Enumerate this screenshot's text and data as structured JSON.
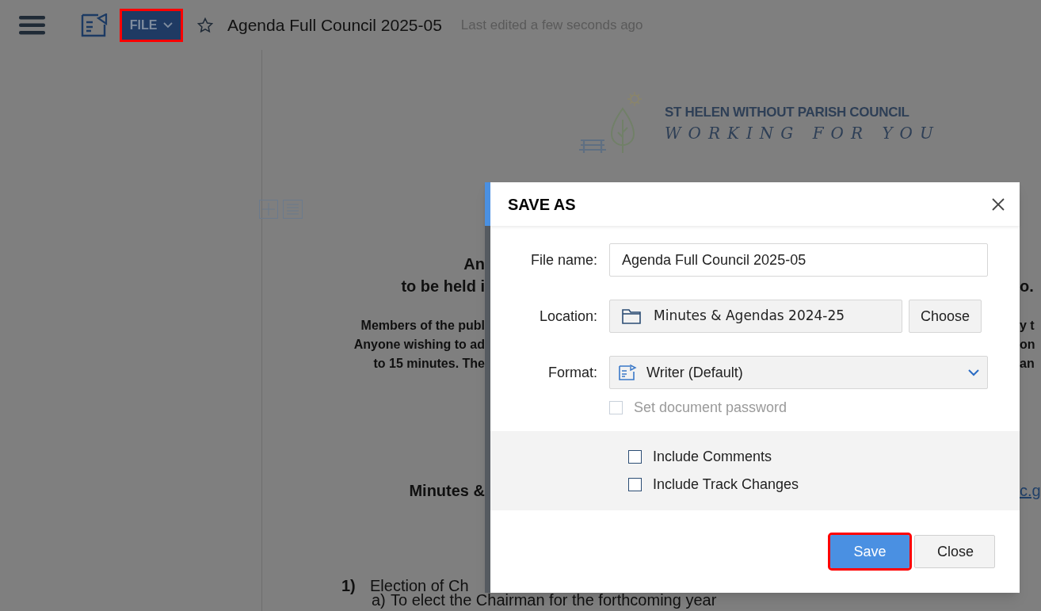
{
  "toolbar": {
    "file_menu": {
      "label": "FILE",
      "highlighted": true
    },
    "starred": false,
    "title": "Agenda Full Council 2025-05",
    "status": "Last edited a few seconds ago"
  },
  "document": {
    "logo": {
      "name": "ST HELEN WITHOUT PARISH COUNCIL",
      "tagline": "WORKING FOR YOU"
    },
    "lines": [
      {
        "kind": "heading",
        "left": "An"
      },
      {
        "kind": "heading",
        "left": "to be held i",
        "right": "o."
      },
      {
        "kind": "body",
        "left": "Members of the publ",
        "right": "y t"
      },
      {
        "kind": "body",
        "left": "Anyone wishing to ad",
        "right": "on"
      },
      {
        "kind": "body",
        "left": "to 15 minutes.  The",
        "right": "an"
      },
      {
        "kind": "link",
        "left": "Minutes &",
        "right": "c.g"
      },
      {
        "kind": "item",
        "number": "1)",
        "left": "Election of Ch"
      },
      {
        "kind": "subitem",
        "number": "a)",
        "left": "To elect the Chairman for the forthcoming year"
      }
    ]
  },
  "dialog": {
    "title": "SAVE AS",
    "fields": [
      {
        "kind": "text",
        "label": "File name:",
        "value": "Agenda Full Council 2025-05"
      },
      {
        "kind": "location",
        "label": "Location:",
        "value": "Minutes & Agendas 2024-25",
        "button": "Choose"
      },
      {
        "kind": "select",
        "label": "Format:",
        "value": "Writer (Default)"
      }
    ],
    "password": {
      "label": "Set document password",
      "checked": false,
      "disabled": true
    },
    "options": [
      {
        "label": "Include Comments",
        "checked": false
      },
      {
        "label": "Include Track Changes",
        "checked": false
      }
    ],
    "buttons": [
      {
        "label": "Save",
        "primary": true,
        "highlighted": true
      },
      {
        "label": "Close",
        "primary": false,
        "highlighted": false
      }
    ]
  }
}
